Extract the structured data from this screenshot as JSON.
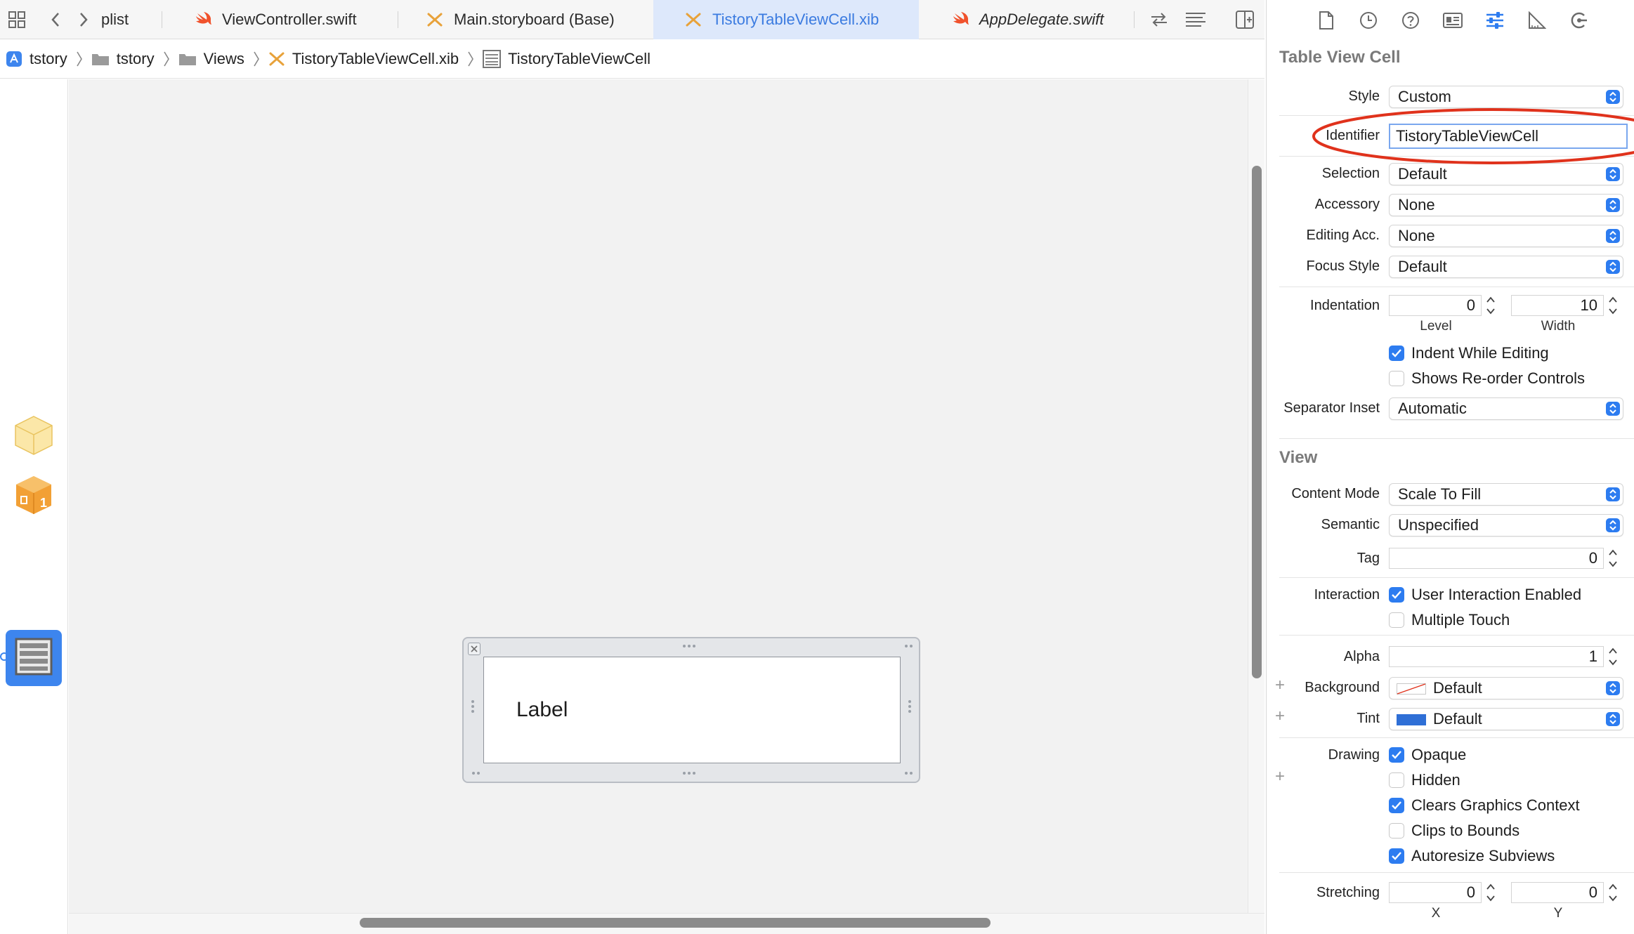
{
  "tabs": [
    {
      "label": "plist",
      "icon": "none"
    },
    {
      "label": "ViewController.swift",
      "icon": "swift-file-icon"
    },
    {
      "label": "Main.storyboard (Base)",
      "icon": "storyboard-file-icon"
    },
    {
      "label": "TistoryTableViewCell.xib",
      "icon": "xib-file-icon",
      "active": true
    },
    {
      "label": "AppDelegate.swift",
      "icon": "swift-file-icon"
    }
  ],
  "breadcrumb": [
    "tstory",
    "tstory",
    "Views",
    "TistoryTableViewCell.xib",
    "TistoryTableViewCell"
  ],
  "canvas": {
    "cell_label": "Label"
  },
  "inspector": {
    "table_view_cell": {
      "title": "Table View Cell",
      "style_label": "Style",
      "style_value": "Custom",
      "identifier_label": "Identifier",
      "identifier_value": "TistoryTableViewCell",
      "selection_label": "Selection",
      "selection_value": "Default",
      "accessory_label": "Accessory",
      "accessory_value": "None",
      "editing_acc_label": "Editing Acc.",
      "editing_acc_value": "None",
      "focus_style_label": "Focus Style",
      "focus_style_value": "Default",
      "indentation_label": "Indentation",
      "indent_level": "0",
      "indent_width": "10",
      "level_label": "Level",
      "width_label": "Width",
      "indent_while_editing": "Indent While Editing",
      "shows_reorder": "Shows Re-order Controls",
      "separator_inset_label": "Separator Inset",
      "separator_inset_value": "Automatic"
    },
    "view": {
      "title": "View",
      "content_mode_label": "Content Mode",
      "content_mode_value": "Scale To Fill",
      "semantic_label": "Semantic",
      "semantic_value": "Unspecified",
      "tag_label": "Tag",
      "tag_value": "0",
      "interaction_label": "Interaction",
      "user_interaction": "User Interaction Enabled",
      "multiple_touch": "Multiple Touch",
      "alpha_label": "Alpha",
      "alpha_value": "1",
      "background_label": "Background",
      "background_value": "Default",
      "tint_label": "Tint",
      "tint_value": "Default",
      "drawing_label": "Drawing",
      "opaque": "Opaque",
      "hidden": "Hidden",
      "clears_graphics": "Clears Graphics Context",
      "clips_bounds": "Clips to Bounds",
      "autoresize": "Autoresize Subviews",
      "stretching_label": "Stretching",
      "stretch_x": "0",
      "stretch_y": "0",
      "x_label": "X",
      "y_label": "Y"
    }
  },
  "colors": {
    "accent": "#2d7cf0",
    "active_tab_bg": "#dde8fb",
    "annotation": "#e0321c",
    "tint_swatch": "#2f6fd6"
  }
}
